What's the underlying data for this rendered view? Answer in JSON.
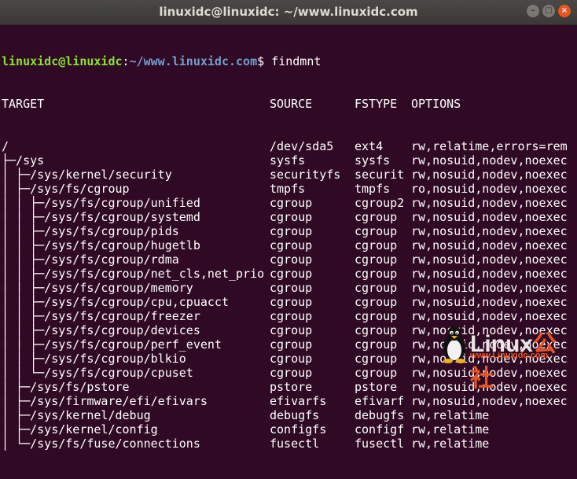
{
  "window": {
    "title": "linuxidc@linuxidc: ~/www.linuxidc.com",
    "controls": {
      "minimize": "–",
      "maximize": "□",
      "close": "×"
    }
  },
  "prompt": {
    "user_host": "linuxidc@linuxidc",
    "separator": ":",
    "path": "~/www.linuxidc.com",
    "symbol": "$",
    "command": " findmnt"
  },
  "headers": [
    "TARGET",
    "SOURCE",
    "FSTYPE",
    "OPTIONS"
  ],
  "rows": [
    [
      "/",
      "/dev/sda5",
      "ext4",
      "rw,relatime,errors=rem"
    ],
    [
      "├─/sys",
      "sysfs",
      "sysfs",
      "rw,nosuid,nodev,noexec"
    ],
    [
      "│ ├─/sys/kernel/security",
      "securityfs",
      "securit",
      "rw,nosuid,nodev,noexec"
    ],
    [
      "│ ├─/sys/fs/cgroup",
      "tmpfs",
      "tmpfs",
      "ro,nosuid,nodev,noexec"
    ],
    [
      "│ │ ├─/sys/fs/cgroup/unified",
      "cgroup",
      "cgroup2",
      "rw,nosuid,nodev,noexec"
    ],
    [
      "│ │ ├─/sys/fs/cgroup/systemd",
      "cgroup",
      "cgroup",
      "rw,nosuid,nodev,noexec"
    ],
    [
      "│ │ ├─/sys/fs/cgroup/pids",
      "cgroup",
      "cgroup",
      "rw,nosuid,nodev,noexec"
    ],
    [
      "│ │ ├─/sys/fs/cgroup/hugetlb",
      "cgroup",
      "cgroup",
      "rw,nosuid,nodev,noexec"
    ],
    [
      "│ │ ├─/sys/fs/cgroup/rdma",
      "cgroup",
      "cgroup",
      "rw,nosuid,nodev,noexec"
    ],
    [
      "│ │ ├─/sys/fs/cgroup/net_cls,net_prio",
      "cgroup",
      "cgroup",
      "rw,nosuid,nodev,noexec"
    ],
    [
      "│ │ ├─/sys/fs/cgroup/memory",
      "cgroup",
      "cgroup",
      "rw,nosuid,nodev,noexec"
    ],
    [
      "│ │ ├─/sys/fs/cgroup/cpu,cpuacct",
      "cgroup",
      "cgroup",
      "rw,nosuid,nodev,noexec"
    ],
    [
      "│ │ ├─/sys/fs/cgroup/freezer",
      "cgroup",
      "cgroup",
      "rw,nosuid,nodev,noexec"
    ],
    [
      "│ │ ├─/sys/fs/cgroup/devices",
      "cgroup",
      "cgroup",
      "rw,nosuid,nodev,noexec"
    ],
    [
      "│ │ ├─/sys/fs/cgroup/perf_event",
      "cgroup",
      "cgroup",
      "rw,nosuid,nodev,noexec"
    ],
    [
      "│ │ ├─/sys/fs/cgroup/blkio",
      "cgroup",
      "cgroup",
      "rw,nosuid,nodev,noexec"
    ],
    [
      "│ │ └─/sys/fs/cgroup/cpuset",
      "cgroup",
      "cgroup",
      "rw,nosuid,nodev,noexec"
    ],
    [
      "│ ├─/sys/fs/pstore",
      "pstore",
      "pstore",
      "rw,nosuid,nodev,noexec"
    ],
    [
      "│ ├─/sys/firmware/efi/efivars",
      "efivarfs",
      "efivarf",
      "rw,nosuid,nodev,noexec"
    ],
    [
      "│ ├─/sys/kernel/debug",
      "debugfs",
      "debugfs",
      "rw,relatime"
    ],
    [
      "│ ├─/sys/kernel/config",
      "configfs",
      "configf",
      "rw,relatime"
    ],
    [
      "│ └─/sys/fs/fuse/connections",
      "fusectl",
      "fusectl",
      "rw,relatime"
    ]
  ],
  "watermark": {
    "brand": "Linux",
    "suffix": "公社",
    "url": "www.Linuxidc.com"
  },
  "colors": {
    "background": "#300a24",
    "user": "#8ae234",
    "path": "#729fcf",
    "close_button": "#e95420"
  }
}
